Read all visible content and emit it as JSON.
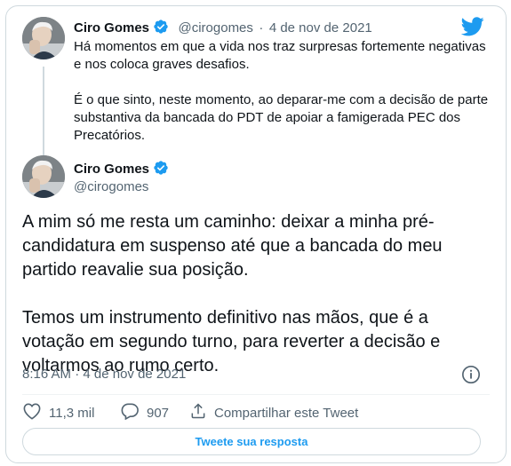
{
  "parent_tweet": {
    "author_name": "Ciro Gomes",
    "handle": "@cirogomes",
    "separator": "·",
    "date": "4 de nov de 2021",
    "text": "Há momentos em que a vida nos traz surpresas fortemente negativas\ne nos coloca graves desafios.\n\nÉ o que sinto, neste momento, ao deparar-me com a decisão de parte\nsubstantiva da bancada do PDT de apoiar a famigerada PEC dos\nPrecatórios."
  },
  "main_tweet": {
    "author_name": "Ciro Gomes",
    "handle": "@cirogomes",
    "text": "A mim só me resta um caminho: deixar a minha pré-\ncandidatura em suspenso até que a bancada do meu\npartido reavalie sua posição.\n\nTemos um instrumento definitivo nas mãos, que é a\nvotação em segundo turno, para  reverter a decisão e\nvoltarmos ao rumo certo.",
    "timestamp": "8:16 AM · 4 de nov de 2021"
  },
  "actions": {
    "likes": "11,3 mil",
    "replies": "907",
    "share_label": "Compartilhar este Tweet"
  },
  "reply_button_label": "Tweete sua resposta",
  "colors": {
    "brand": "#1d9bf0",
    "like": "#536471",
    "text": "#0f1419",
    "muted": "#536471"
  },
  "icons": [
    "twitter-bird-icon",
    "verified-badge-icon",
    "info-icon",
    "heart-icon",
    "comment-icon",
    "share-icon"
  ]
}
